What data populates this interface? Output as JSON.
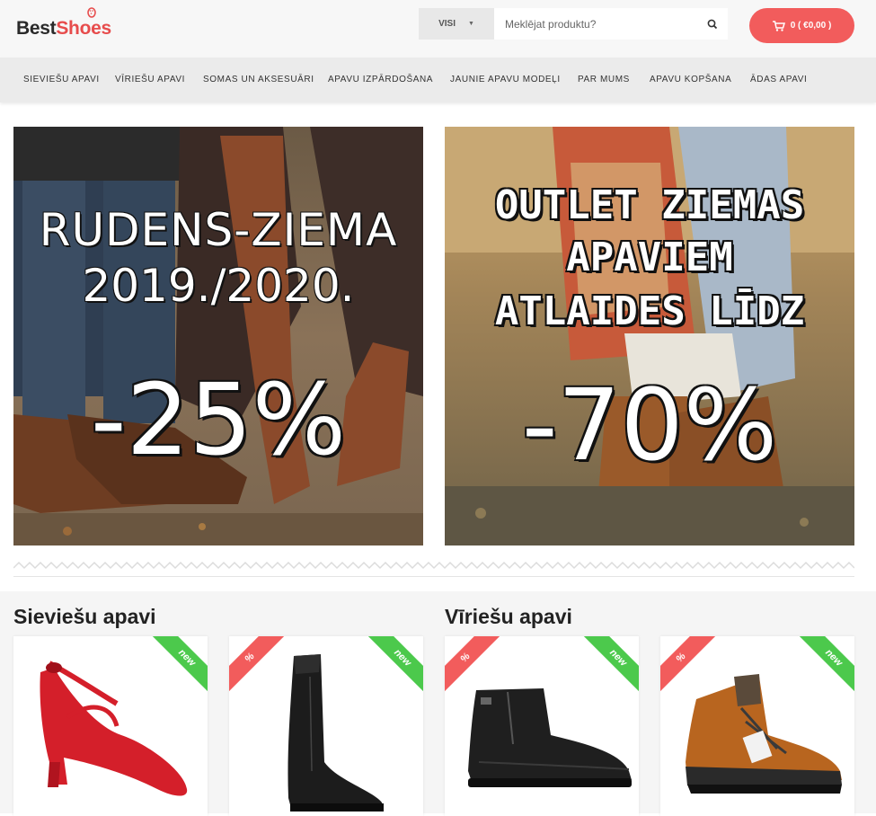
{
  "header": {
    "logo_best": "Best",
    "logo_shoes": "Shoes",
    "search_category": "VISI",
    "search_placeholder": "Meklējat produktu?",
    "cart_label": "0 ( €0,00 )"
  },
  "nav": {
    "items": [
      "SIEVIEŠU APAVI",
      "VĪRIEŠU APAVI",
      "SOMAS UN AKSESUĀRI",
      "APAVU IZPĀRDOŠANA",
      "JAUNIE APAVU MODEĻI",
      "PAR MUMS",
      "APAVU KOPŠANA",
      "ĀDAS APAVI"
    ]
  },
  "banners": {
    "left": {
      "line1": "RUDENS-ZIEMA",
      "line2": "2019./2020.",
      "discount": "-25%"
    },
    "right": {
      "line1": "OUTLET ZIEMAS",
      "line2": "APAVIEM",
      "line3": "ATLAIDES LĪDZ",
      "discount": "-70%"
    }
  },
  "sections": {
    "women_title": "Sieviešu apavi",
    "men_title": "Vīriešu apavi"
  },
  "products": [
    {
      "name": "red-heel-pump",
      "badges": [
        "new"
      ],
      "new_label": "new",
      "sale_label": "%"
    },
    {
      "name": "black-tall-boot",
      "badges": [
        "sale",
        "new"
      ],
      "new_label": "new",
      "sale_label": "%"
    },
    {
      "name": "black-ankle-boot",
      "badges": [
        "sale",
        "new"
      ],
      "new_label": "new",
      "sale_label": "%"
    },
    {
      "name": "brown-hiking-boot",
      "badges": [
        "sale",
        "new"
      ],
      "new_label": "new",
      "sale_label": "%"
    }
  ],
  "colors": {
    "accent": "#f25c5c",
    "new_badge": "#4cc94c",
    "nav_bg": "#ebebeb"
  }
}
